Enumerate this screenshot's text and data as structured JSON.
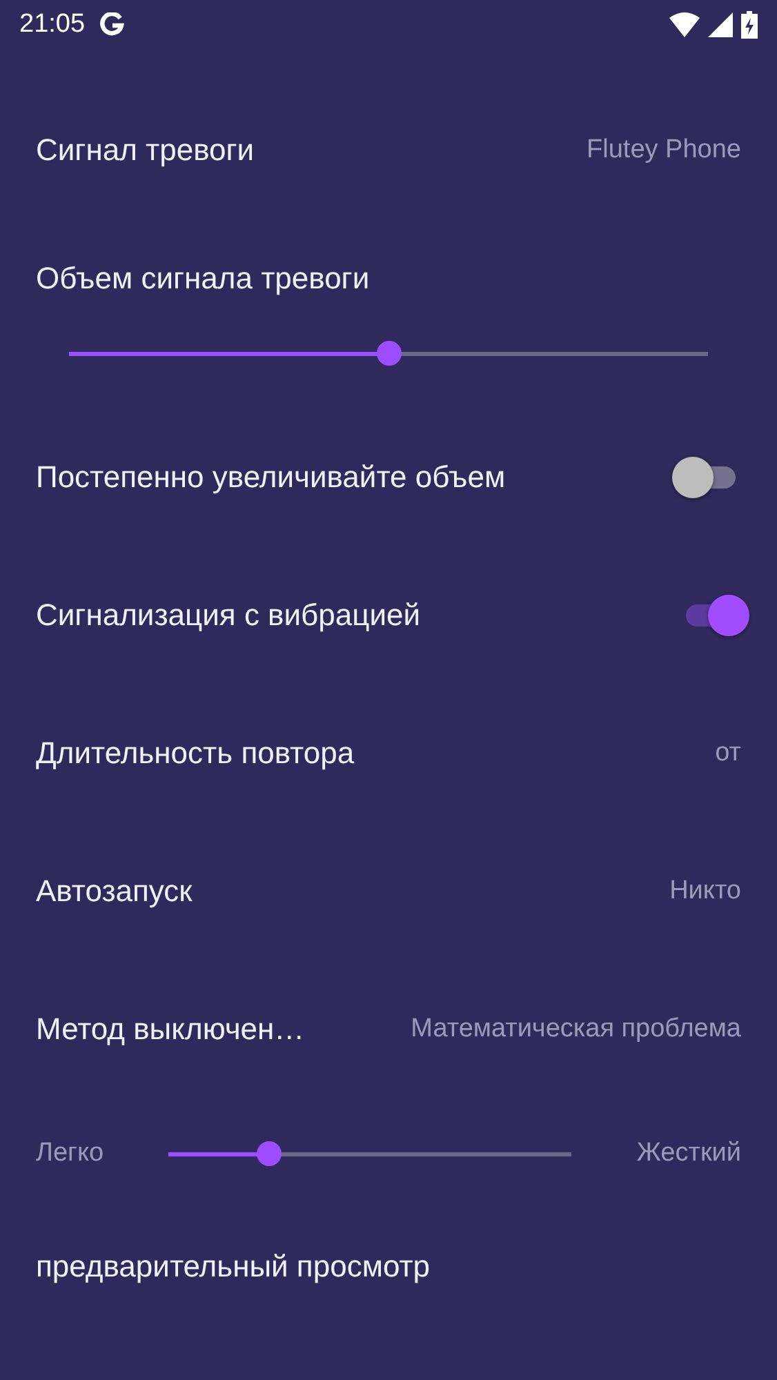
{
  "status_bar": {
    "time": "21:05"
  },
  "settings": [
    {
      "kind": "value",
      "label": "Сигнал тревоги",
      "value": "Flutey Phone"
    },
    {
      "kind": "slider",
      "label": "Объем сигнала тревоги",
      "level": 0.5
    },
    {
      "kind": "toggle",
      "label": "Постепенно увеличивайте объем",
      "on": false
    },
    {
      "kind": "toggle",
      "label": "Сигнализация с вибрацией",
      "on": true
    },
    {
      "kind": "value",
      "label": "Длительность повтора",
      "value": "от"
    },
    {
      "kind": "value",
      "label": "Автозапуск",
      "value": "Никто"
    },
    {
      "kind": "value",
      "label": "Метод выключен…",
      "value": "Математическая проблема"
    },
    {
      "kind": "range",
      "min_label": "Легко",
      "max_label": "Жесткий",
      "level": 0.25
    },
    {
      "kind": "action",
      "label": "предварительный просмотр"
    }
  ]
}
